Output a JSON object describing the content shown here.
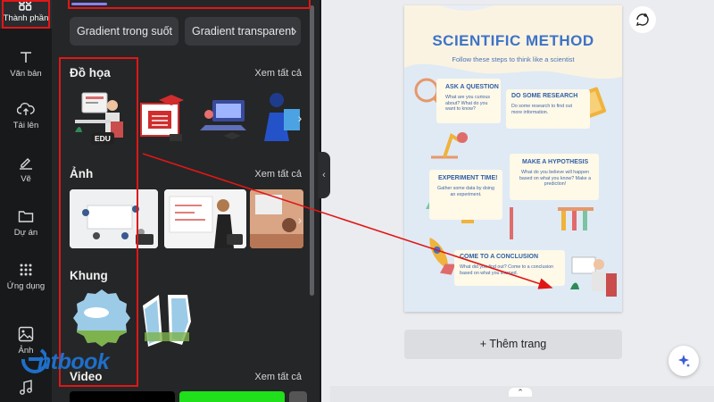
{
  "rail": {
    "items": [
      {
        "label": "Thành phần",
        "icon": "elements-icon"
      },
      {
        "label": "Văn bản",
        "icon": "text-icon"
      },
      {
        "label": "Tải lên",
        "icon": "upload-cloud-icon"
      },
      {
        "label": "Vẽ",
        "icon": "draw-pen-icon"
      },
      {
        "label": "Dự án",
        "icon": "folder-icon"
      },
      {
        "label": "Ứng dụng",
        "icon": "apps-grid-icon"
      },
      {
        "label": "Ảnh",
        "icon": "photo-icon"
      },
      {
        "label": "",
        "icon": "music-icon"
      }
    ]
  },
  "panel": {
    "chips": [
      "Gradient trong suốt",
      "Gradient transparent"
    ],
    "sections": {
      "graphics": {
        "title": "Đồ họa",
        "see_all": "Xem tất cả",
        "badge": "EDU"
      },
      "photos": {
        "title": "Ảnh",
        "see_all": "Xem tất cả"
      },
      "frames": {
        "title": "Khung"
      },
      "video": {
        "title": "Video",
        "see_all": "Xem tất cả"
      }
    }
  },
  "poster": {
    "title": "SCIENTIFIC METHOD",
    "subtitle": "Follow these steps to think like a scientist",
    "cards": [
      {
        "title": "ASK A QUESTION",
        "text": "What are you curious about? What do you want to know?"
      },
      {
        "title": "DO SOME RESEARCH",
        "text": "Do some research to find out more information."
      },
      {
        "title": "EXPERIMENT TIME!",
        "text": "Gather some data by doing an experiment."
      },
      {
        "title": "MAKE A HYPOTHESIS",
        "text": "What do you believe will happen based on what you know? Make a prediction!"
      },
      {
        "title": "COME TO A CONCLUSION",
        "text": "What did you find out? Come to a conclusion based on what you learned."
      }
    ]
  },
  "canvas": {
    "add_page": "+ Thêm trang"
  },
  "watermark": {
    "text": "ntbook"
  },
  "colors": {
    "annotation_red": "#e01717",
    "poster_blue": "#3c73c8",
    "poster_bg": "#fbf3e1",
    "panel_bg": "#252627"
  }
}
